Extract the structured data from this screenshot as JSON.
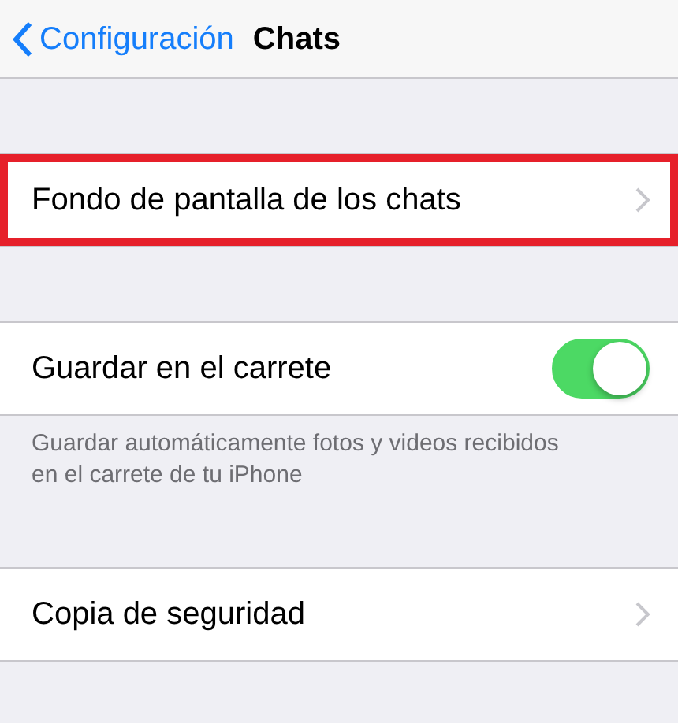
{
  "nav": {
    "back": "Configuración",
    "title": "Chats"
  },
  "sections": [
    {
      "rows": [
        {
          "kind": "link",
          "label": "Fondo de pantalla de los chats",
          "highlighted": true
        }
      ]
    },
    {
      "rows": [
        {
          "kind": "toggle",
          "label": "Guardar en el carrete",
          "on": true,
          "highlighted": false
        }
      ],
      "footer": "Guardar automáticamente fotos y videos recibidos en el carrete de tu iPhone"
    },
    {
      "rows": [
        {
          "kind": "link",
          "label": "Copia de seguridad",
          "highlighted": false
        }
      ]
    }
  ]
}
